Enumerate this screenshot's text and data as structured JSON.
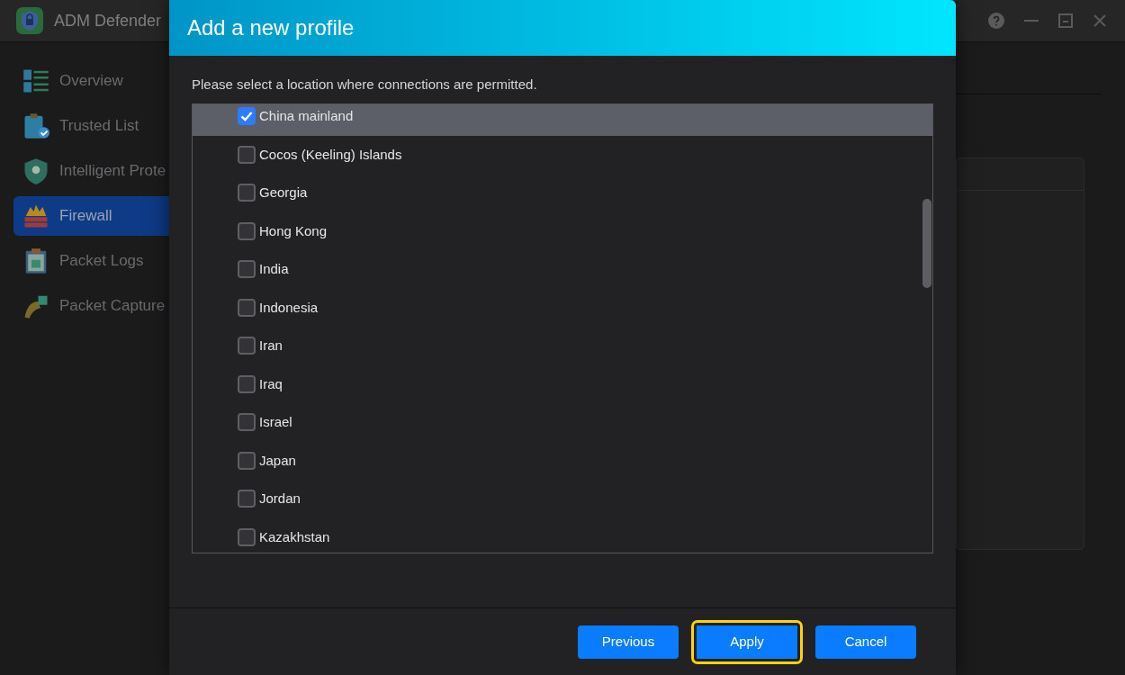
{
  "app": {
    "title": "ADM Defender"
  },
  "sidebar": {
    "items": [
      {
        "label": "Overview",
        "selected": false
      },
      {
        "label": "Trusted List",
        "selected": false
      },
      {
        "label": "Intelligent Prote",
        "selected": false
      },
      {
        "label": "Firewall",
        "selected": true
      },
      {
        "label": "Packet Logs",
        "selected": false
      },
      {
        "label": "Packet Capture",
        "selected": false
      }
    ]
  },
  "dialog": {
    "title": "Add a new profile",
    "instruction": "Please select a location where connections are permitted.",
    "locations": [
      {
        "label": "China mainland",
        "checked": true,
        "selected": true
      },
      {
        "label": "Cocos (Keeling) Islands",
        "checked": false,
        "selected": false
      },
      {
        "label": "Georgia",
        "checked": false,
        "selected": false
      },
      {
        "label": "Hong Kong",
        "checked": false,
        "selected": false
      },
      {
        "label": "India",
        "checked": false,
        "selected": false
      },
      {
        "label": "Indonesia",
        "checked": false,
        "selected": false
      },
      {
        "label": "Iran",
        "checked": false,
        "selected": false
      },
      {
        "label": "Iraq",
        "checked": false,
        "selected": false
      },
      {
        "label": "Israel",
        "checked": false,
        "selected": false
      },
      {
        "label": "Japan",
        "checked": false,
        "selected": false
      },
      {
        "label": "Jordan",
        "checked": false,
        "selected": false
      },
      {
        "label": "Kazakhstan",
        "checked": false,
        "selected": false
      }
    ],
    "buttons": [
      {
        "label": "Previous",
        "focused": false
      },
      {
        "label": "Apply",
        "focused": true
      },
      {
        "label": "Cancel",
        "focused": false
      }
    ]
  }
}
